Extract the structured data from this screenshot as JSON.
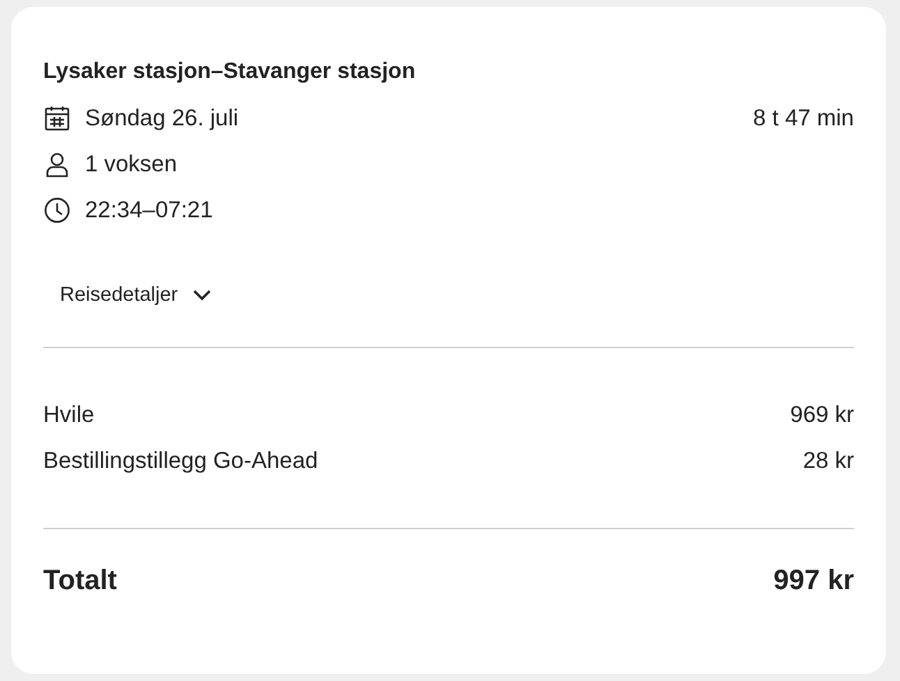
{
  "title": "Lysaker stasjon–Stavanger stasjon",
  "details": [
    {
      "kind": "date",
      "text": "Søndag 26. juli",
      "extra": "8 t 47 min"
    },
    {
      "kind": "person",
      "text": "1 voksen"
    },
    {
      "kind": "time",
      "text": "22:34–07:21"
    }
  ],
  "expander": {
    "label": "Reisedetaljer",
    "expanded": false
  },
  "lines": [
    {
      "label": "Hvile",
      "amount": "969 kr"
    },
    {
      "label": "Bestillingstillegg Go-Ahead",
      "amount": "28 kr"
    }
  ],
  "total": {
    "label": "Totalt",
    "amount": "997 kr"
  }
}
